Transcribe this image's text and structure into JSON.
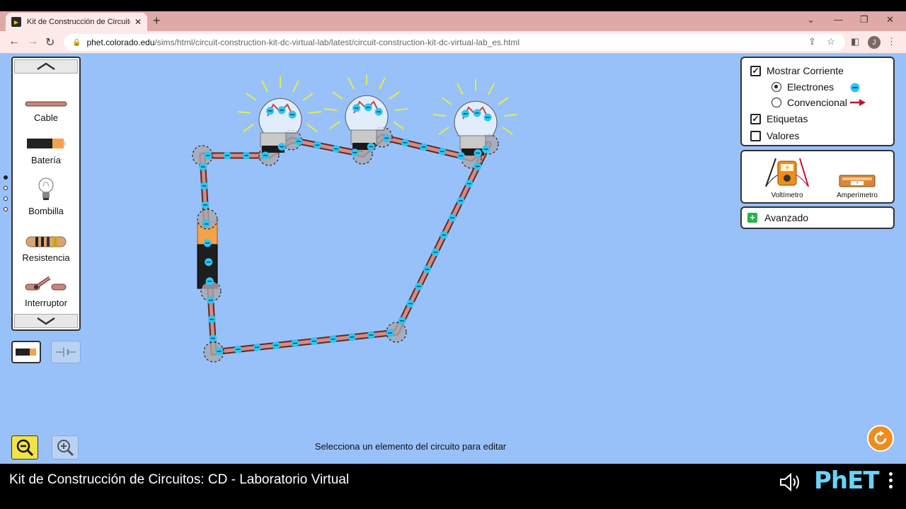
{
  "browser": {
    "tab_title": "Kit de Construcción de Circuitos:",
    "favicon": "PhET",
    "url_host": "phet.colorado.edu",
    "url_path": "/sims/html/circuit-construction-kit-dc-virtual-lab/latest/circuit-construction-kit-dc-virtual-lab_es.html",
    "avatar_letter": "J"
  },
  "toolbox": {
    "items": [
      {
        "label": "Cable",
        "icon": "wire-icon"
      },
      {
        "label": "Batería",
        "icon": "battery-icon"
      },
      {
        "label": "Bombilla",
        "icon": "bulb-icon"
      },
      {
        "label": "Resistencia",
        "icon": "resistor-icon"
      },
      {
        "label": "Interruptor",
        "icon": "switch-icon"
      }
    ]
  },
  "controls": {
    "show_current_label": "Mostrar Corriente",
    "show_current_checked": true,
    "electrons_label": "Electrones",
    "conventional_label": "Convencional",
    "labels_label": "Etiquetas",
    "labels_checked": true,
    "values_label": "Valores",
    "values_checked": false,
    "electron_color": "#2ec5f2",
    "arrow_color": "#c8102e"
  },
  "meters": {
    "voltmeter_label": "Voltímetro",
    "ammeter_label": "Amperímetro",
    "voltmeter_readout": "?",
    "ammeter_readout": "?"
  },
  "advanced": {
    "label": "Avanzado"
  },
  "status_text": "Selecciona un elemento del circuito para editar",
  "nav": {
    "title": "Kit de Construcción de Circuitos: CD - Laboratorio Virtual",
    "logo": "PhET"
  }
}
